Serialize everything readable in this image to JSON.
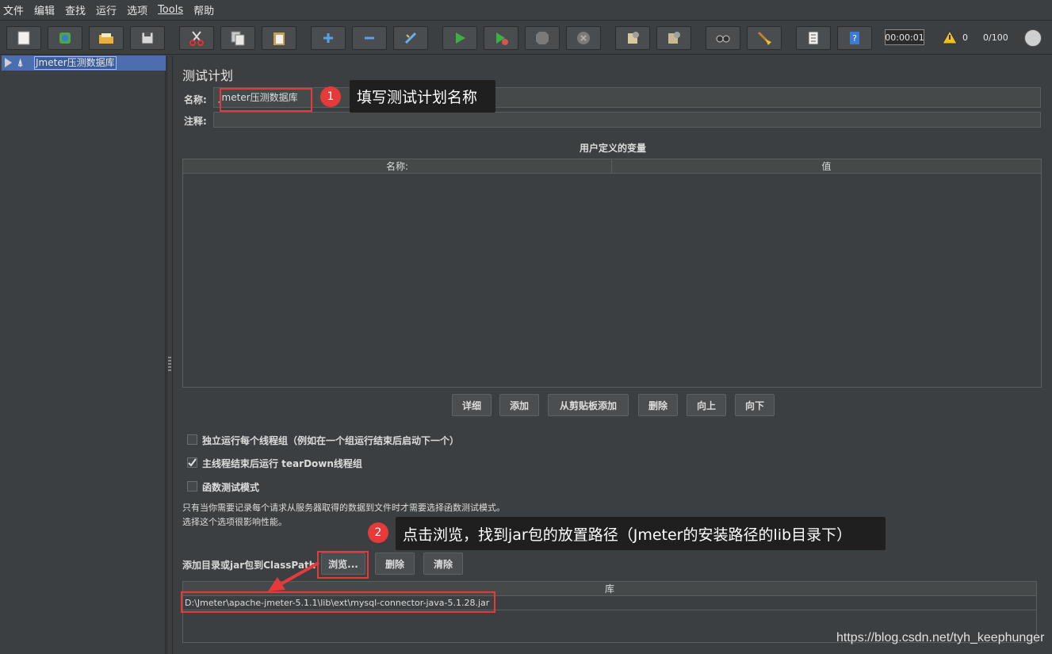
{
  "menu": [
    "文件",
    "编辑",
    "查找",
    "运行",
    "选项",
    "Tools",
    "帮助"
  ],
  "toolbar": {
    "buttons": [
      "new-icon",
      "templates-icon",
      "open-icon",
      "save-icon",
      "cut-icon",
      "copy-icon",
      "paste-icon",
      "expand-icon",
      "collapse-icon",
      "toggle-icon",
      "start-icon",
      "start-no-pause-icon",
      "stop-icon",
      "shutdown-icon",
      "clear-icon",
      "clear-all-icon",
      "search-icon",
      "reset-search-icon",
      "function-helper-icon",
      "help-icon"
    ],
    "timer": "00:00:01",
    "warnings": "0",
    "threads": "0/100"
  },
  "tree": {
    "root_label": "Jmeter压测数据库"
  },
  "panel": {
    "title": "测试计划",
    "name_label": "名称:",
    "name_value": "Jmeter压测数据库",
    "comment_label": "注释:",
    "vars_title": "用户定义的变量",
    "col_name": "名称:",
    "col_value": "值",
    "buttons": {
      "detail": "详细",
      "add": "添加",
      "add_clipboard": "从剪贴板添加",
      "delete": "删除",
      "up": "向上",
      "down": "向下"
    },
    "checkboxes": [
      {
        "label": "独立运行每个线程组（例如在一个组运行结束后启动下一个）",
        "checked": false
      },
      {
        "label": "主线程结束后运行 tearDown线程组",
        "checked": true
      },
      {
        "label": "函数测试模式",
        "checked": false
      }
    ],
    "note_line1": "只有当你需要记录每个请求从服务器取得的数据到文件时才需要选择函数测试模式。",
    "note_line2": "选择这个选项很影响性能。",
    "classpath_label": "添加目录或jar包到ClassPath",
    "browse": "浏览...",
    "cp_delete": "删除",
    "cp_clear": "清除",
    "lib_header": "库",
    "lib_path": "D:\\Jmeter\\apache-jmeter-5.1.1\\lib\\ext\\mysql-connector-java-5.1.28.jar"
  },
  "annotations": {
    "badge1": "1",
    "callout1": "填写测试计划名称",
    "badge2": "2",
    "callout2": "点击浏览，找到jar包的放置路径（Jmeter的安装路径的lib目录下）",
    "watermark": "https://blog.csdn.net/tyh_keephunger"
  },
  "colors": {
    "annotation_red": "#e63a3a",
    "selection": "#4b6eaf",
    "background": "#3c3f41"
  }
}
